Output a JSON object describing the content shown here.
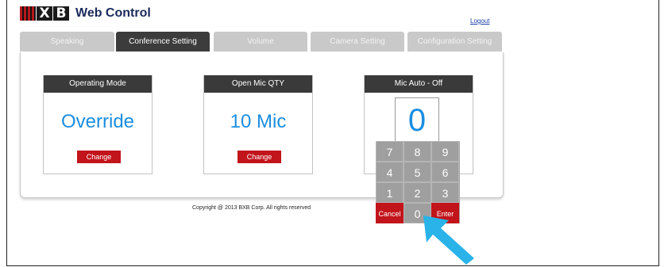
{
  "header": {
    "logo_text": "BXB",
    "app_title": "Web Control",
    "logout_label": "Logout"
  },
  "tabs": [
    {
      "label": "Speaking",
      "active": false
    },
    {
      "label": "Conference Setting",
      "active": true
    },
    {
      "label": "Volume",
      "active": false
    },
    {
      "label": "Camera Setting",
      "active": false
    },
    {
      "label": "Configuration Setting",
      "active": false
    }
  ],
  "cards": {
    "operating_mode": {
      "title": "Operating Mode",
      "value": "Override",
      "button": "Change"
    },
    "open_mic": {
      "title": "Open Mic QTY",
      "value": "10 Mic",
      "button": "Change"
    },
    "mic_auto": {
      "title": "Mic Auto - Off"
    }
  },
  "keypad": {
    "display": "0",
    "rows": [
      [
        "7",
        "8",
        "9"
      ],
      [
        "4",
        "5",
        "6"
      ],
      [
        "1",
        "2",
        "3"
      ]
    ],
    "cancel_label": "Cancel",
    "zero_label": "0",
    "enter_label": "Enter"
  },
  "footer": {
    "copyright": "Copyright @ 2013 BXB Corp. All rights reserved"
  },
  "colors": {
    "accent_blue": "#1b8ee0",
    "button_red": "#c2141b",
    "tab_active": "#3c3c3c",
    "tab_inactive": "#c9c9c9",
    "pointer_arrow": "#2ab3e8"
  }
}
